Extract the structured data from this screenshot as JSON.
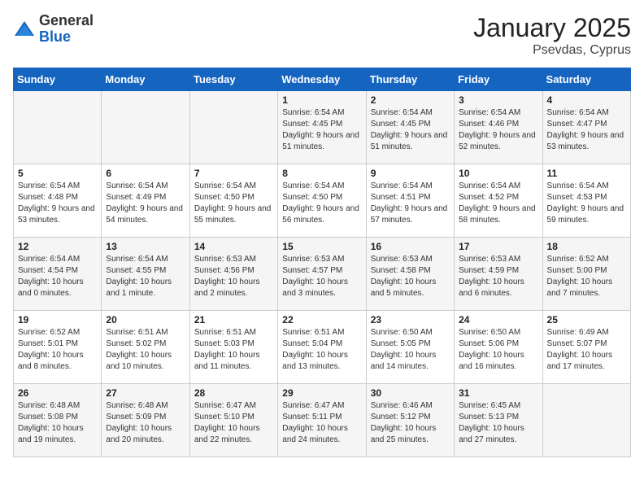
{
  "header": {
    "logo_general": "General",
    "logo_blue": "Blue",
    "month": "January 2025",
    "location": "Psevdas, Cyprus"
  },
  "weekdays": [
    "Sunday",
    "Monday",
    "Tuesday",
    "Wednesday",
    "Thursday",
    "Friday",
    "Saturday"
  ],
  "weeks": [
    [
      {
        "day": "",
        "sunrise": "",
        "sunset": "",
        "daylight": ""
      },
      {
        "day": "",
        "sunrise": "",
        "sunset": "",
        "daylight": ""
      },
      {
        "day": "",
        "sunrise": "",
        "sunset": "",
        "daylight": ""
      },
      {
        "day": "1",
        "sunrise": "Sunrise: 6:54 AM",
        "sunset": "Sunset: 4:45 PM",
        "daylight": "Daylight: 9 hours and 51 minutes."
      },
      {
        "day": "2",
        "sunrise": "Sunrise: 6:54 AM",
        "sunset": "Sunset: 4:45 PM",
        "daylight": "Daylight: 9 hours and 51 minutes."
      },
      {
        "day": "3",
        "sunrise": "Sunrise: 6:54 AM",
        "sunset": "Sunset: 4:46 PM",
        "daylight": "Daylight: 9 hours and 52 minutes."
      },
      {
        "day": "4",
        "sunrise": "Sunrise: 6:54 AM",
        "sunset": "Sunset: 4:47 PM",
        "daylight": "Daylight: 9 hours and 53 minutes."
      }
    ],
    [
      {
        "day": "5",
        "sunrise": "Sunrise: 6:54 AM",
        "sunset": "Sunset: 4:48 PM",
        "daylight": "Daylight: 9 hours and 53 minutes."
      },
      {
        "day": "6",
        "sunrise": "Sunrise: 6:54 AM",
        "sunset": "Sunset: 4:49 PM",
        "daylight": "Daylight: 9 hours and 54 minutes."
      },
      {
        "day": "7",
        "sunrise": "Sunrise: 6:54 AM",
        "sunset": "Sunset: 4:50 PM",
        "daylight": "Daylight: 9 hours and 55 minutes."
      },
      {
        "day": "8",
        "sunrise": "Sunrise: 6:54 AM",
        "sunset": "Sunset: 4:50 PM",
        "daylight": "Daylight: 9 hours and 56 minutes."
      },
      {
        "day": "9",
        "sunrise": "Sunrise: 6:54 AM",
        "sunset": "Sunset: 4:51 PM",
        "daylight": "Daylight: 9 hours and 57 minutes."
      },
      {
        "day": "10",
        "sunrise": "Sunrise: 6:54 AM",
        "sunset": "Sunset: 4:52 PM",
        "daylight": "Daylight: 9 hours and 58 minutes."
      },
      {
        "day": "11",
        "sunrise": "Sunrise: 6:54 AM",
        "sunset": "Sunset: 4:53 PM",
        "daylight": "Daylight: 9 hours and 59 minutes."
      }
    ],
    [
      {
        "day": "12",
        "sunrise": "Sunrise: 6:54 AM",
        "sunset": "Sunset: 4:54 PM",
        "daylight": "Daylight: 10 hours and 0 minutes."
      },
      {
        "day": "13",
        "sunrise": "Sunrise: 6:54 AM",
        "sunset": "Sunset: 4:55 PM",
        "daylight": "Daylight: 10 hours and 1 minute."
      },
      {
        "day": "14",
        "sunrise": "Sunrise: 6:53 AM",
        "sunset": "Sunset: 4:56 PM",
        "daylight": "Daylight: 10 hours and 2 minutes."
      },
      {
        "day": "15",
        "sunrise": "Sunrise: 6:53 AM",
        "sunset": "Sunset: 4:57 PM",
        "daylight": "Daylight: 10 hours and 3 minutes."
      },
      {
        "day": "16",
        "sunrise": "Sunrise: 6:53 AM",
        "sunset": "Sunset: 4:58 PM",
        "daylight": "Daylight: 10 hours and 5 minutes."
      },
      {
        "day": "17",
        "sunrise": "Sunrise: 6:53 AM",
        "sunset": "Sunset: 4:59 PM",
        "daylight": "Daylight: 10 hours and 6 minutes."
      },
      {
        "day": "18",
        "sunrise": "Sunrise: 6:52 AM",
        "sunset": "Sunset: 5:00 PM",
        "daylight": "Daylight: 10 hours and 7 minutes."
      }
    ],
    [
      {
        "day": "19",
        "sunrise": "Sunrise: 6:52 AM",
        "sunset": "Sunset: 5:01 PM",
        "daylight": "Daylight: 10 hours and 8 minutes."
      },
      {
        "day": "20",
        "sunrise": "Sunrise: 6:51 AM",
        "sunset": "Sunset: 5:02 PM",
        "daylight": "Daylight: 10 hours and 10 minutes."
      },
      {
        "day": "21",
        "sunrise": "Sunrise: 6:51 AM",
        "sunset": "Sunset: 5:03 PM",
        "daylight": "Daylight: 10 hours and 11 minutes."
      },
      {
        "day": "22",
        "sunrise": "Sunrise: 6:51 AM",
        "sunset": "Sunset: 5:04 PM",
        "daylight": "Daylight: 10 hours and 13 minutes."
      },
      {
        "day": "23",
        "sunrise": "Sunrise: 6:50 AM",
        "sunset": "Sunset: 5:05 PM",
        "daylight": "Daylight: 10 hours and 14 minutes."
      },
      {
        "day": "24",
        "sunrise": "Sunrise: 6:50 AM",
        "sunset": "Sunset: 5:06 PM",
        "daylight": "Daylight: 10 hours and 16 minutes."
      },
      {
        "day": "25",
        "sunrise": "Sunrise: 6:49 AM",
        "sunset": "Sunset: 5:07 PM",
        "daylight": "Daylight: 10 hours and 17 minutes."
      }
    ],
    [
      {
        "day": "26",
        "sunrise": "Sunrise: 6:48 AM",
        "sunset": "Sunset: 5:08 PM",
        "daylight": "Daylight: 10 hours and 19 minutes."
      },
      {
        "day": "27",
        "sunrise": "Sunrise: 6:48 AM",
        "sunset": "Sunset: 5:09 PM",
        "daylight": "Daylight: 10 hours and 20 minutes."
      },
      {
        "day": "28",
        "sunrise": "Sunrise: 6:47 AM",
        "sunset": "Sunset: 5:10 PM",
        "daylight": "Daylight: 10 hours and 22 minutes."
      },
      {
        "day": "29",
        "sunrise": "Sunrise: 6:47 AM",
        "sunset": "Sunset: 5:11 PM",
        "daylight": "Daylight: 10 hours and 24 minutes."
      },
      {
        "day": "30",
        "sunrise": "Sunrise: 6:46 AM",
        "sunset": "Sunset: 5:12 PM",
        "daylight": "Daylight: 10 hours and 25 minutes."
      },
      {
        "day": "31",
        "sunrise": "Sunrise: 6:45 AM",
        "sunset": "Sunset: 5:13 PM",
        "daylight": "Daylight: 10 hours and 27 minutes."
      },
      {
        "day": "",
        "sunrise": "",
        "sunset": "",
        "daylight": ""
      }
    ]
  ]
}
